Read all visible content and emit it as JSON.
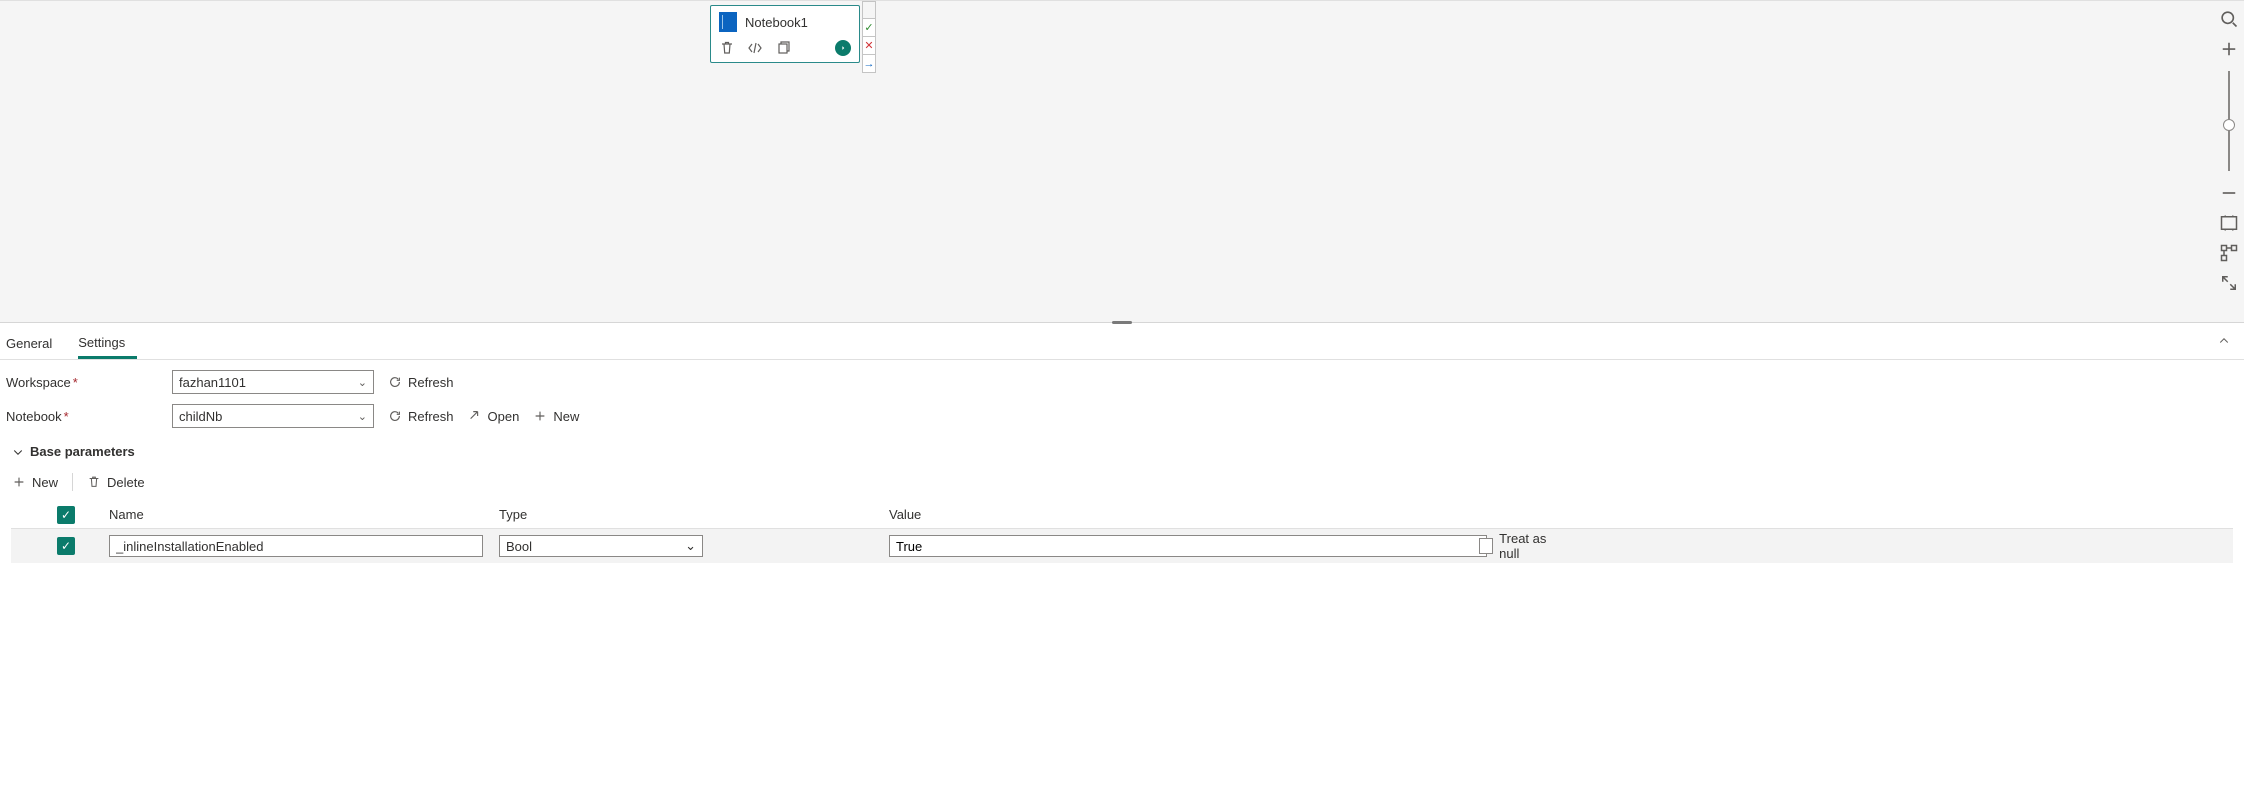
{
  "node": {
    "title": "Notebook1"
  },
  "tabs": {
    "general": "General",
    "settings": "Settings"
  },
  "form": {
    "workspace_label": "Workspace",
    "workspace_value": "fazhan1101",
    "notebook_label": "Notebook",
    "notebook_value": "childNb",
    "refresh": "Refresh",
    "open": "Open",
    "new": "New"
  },
  "section": {
    "base_params": "Base parameters"
  },
  "toolbar": {
    "new": "New",
    "delete": "Delete"
  },
  "columns": {
    "name": "Name",
    "type": "Type",
    "value": "Value"
  },
  "row": {
    "name": "_inlineInstallationEnabled",
    "type": "Bool",
    "value": "True",
    "treat_as_null": "Treat as null"
  }
}
